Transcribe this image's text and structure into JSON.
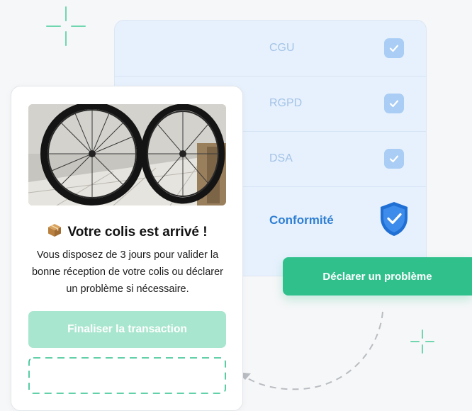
{
  "compliance": {
    "items": [
      {
        "label": "CGU",
        "checked": true
      },
      {
        "label": "RGPD",
        "checked": true
      },
      {
        "label": "DSA",
        "checked": true
      }
    ],
    "main": {
      "label": "Conformité",
      "icon": "shield-check-icon"
    }
  },
  "notification": {
    "icon": "package-icon",
    "title": "Votre colis est arrivé !",
    "body": "Vous disposez de 3 jours pour valider la bonne réception de votre colis ou déclarer un problème si nécessaire.",
    "finalize_label": "Finaliser la transaction"
  },
  "problem_button": {
    "label": "Déclarer un problème"
  },
  "colors": {
    "green": "#2fc08c",
    "green_light": "#a9e6cf",
    "blue": "#2f7fd3",
    "blue_light": "#a9cdf4",
    "panel_bg": "#e7f1fd"
  }
}
